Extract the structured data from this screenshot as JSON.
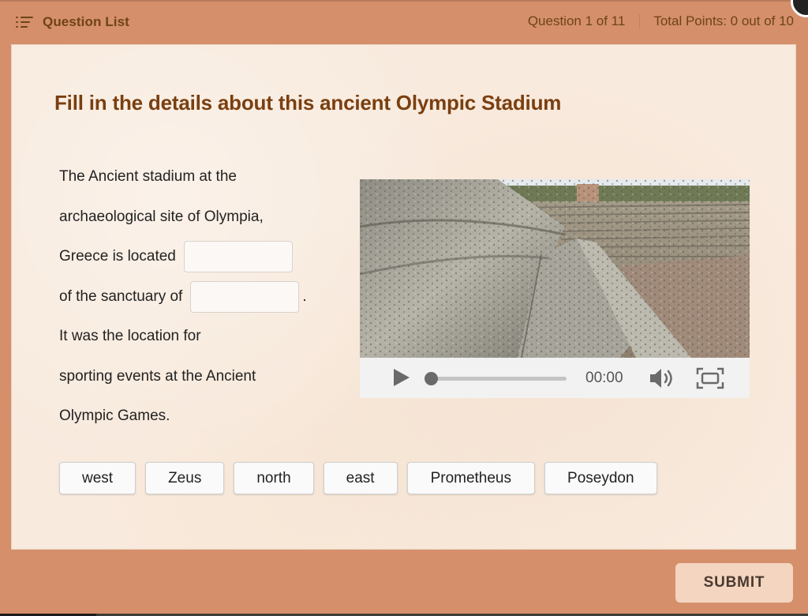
{
  "header": {
    "question_list_label": "Question List",
    "question_counter": "Question 1 of 11",
    "total_points": "Total Points: 0 out of 10"
  },
  "question": {
    "title": "Fill in the details about this ancient Olympic Stadium",
    "passage": {
      "line1": "The Ancient stadium at the",
      "line2": "archaeological site of Olympia,",
      "line3": "Greece is located",
      "line4": "of the sanctuary of",
      "line4_end": ".",
      "line5": "It was the location for",
      "line6": "sporting events at the Ancient",
      "line7": "Olympic Games."
    },
    "blanks": [
      {
        "value": "",
        "placeholder": ""
      },
      {
        "value": "",
        "placeholder": ""
      }
    ]
  },
  "media": {
    "description": "Photo of stone seating steps at the ancient stadium",
    "time": "00:00",
    "progress_fraction": 0
  },
  "choices": [
    "west",
    "Zeus",
    "north",
    "east",
    "Prometheus",
    "Poseydon"
  ],
  "footer": {
    "submit_label": "SUBMIT"
  },
  "colors": {
    "frame": "#d58f6b",
    "panel": "#f8eadd",
    "title": "#7a3f10",
    "header_text": "#6e4416",
    "submit_bg": "#f3d5c0"
  }
}
